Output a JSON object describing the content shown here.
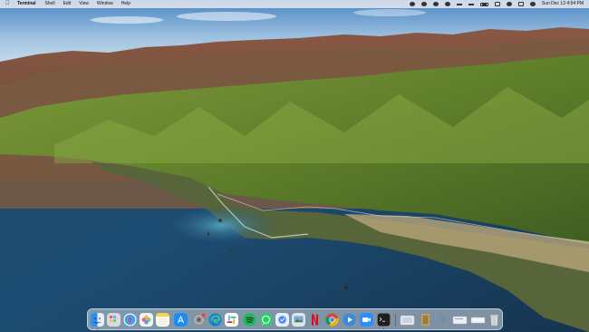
{
  "menubar": {
    "apple_icon": "apple-icon",
    "app_name": "Terminal",
    "menus": [
      "Shell",
      "Edit",
      "View",
      "Window",
      "Help"
    ],
    "status_icons": [
      "dropbox-icon",
      "clock-icon",
      "creative-cloud-icon",
      "dark-mode-icon",
      "bluetooth-icon",
      "volume-icon",
      "battery-icon",
      "wifi-icon",
      "search-icon",
      "control-center-icon",
      "siri-icon"
    ],
    "clock": "Sun Dec 13  4:54 PM"
  },
  "dock": {
    "apps": [
      {
        "name": "finder-icon",
        "color": "#2f8ff0"
      },
      {
        "name": "launchpad-icon",
        "color": "#d9d9de"
      },
      {
        "name": "safari-icon",
        "color": "#3aa2f0"
      },
      {
        "name": "photos-icon",
        "color": "#f4f4f4"
      },
      {
        "name": "notes-icon",
        "color": "#f7e38a"
      },
      {
        "name": "app-store-icon",
        "color": "#1c8cf5"
      },
      {
        "name": "system-preferences-icon",
        "color": "#8e8e93"
      },
      {
        "name": "edge-icon",
        "color": "#1a7dd7"
      },
      {
        "name": "slack-icon",
        "color": "#ffffff"
      },
      {
        "name": "spotify-icon",
        "color": "#1db954"
      },
      {
        "name": "whatsapp-icon",
        "color": "#25d366"
      },
      {
        "name": "things-icon",
        "color": "#e8eef6"
      },
      {
        "name": "preview-icon",
        "color": "#dfe5ec"
      },
      {
        "name": "netflix-icon",
        "color": "#e50914"
      },
      {
        "name": "chrome-icon",
        "color": "#f2f2f2"
      },
      {
        "name": "infuse-icon",
        "color": "#3a8bd8"
      },
      {
        "name": "zoom-icon",
        "color": "#2d8cff"
      },
      {
        "name": "terminal-icon",
        "color": "#1f1f1f"
      }
    ],
    "others": [
      {
        "name": "screenshot-folder-icon",
        "color": "#e8ecf0"
      },
      {
        "name": "downloads-stack-icon",
        "color": "#c9a45c"
      },
      {
        "name": "help-stack-icon",
        "color": "#d8dce2"
      },
      {
        "name": "documents-stack-icon",
        "color": "#eef1f4"
      },
      {
        "name": "window-stack-icon",
        "color": "#f4f4f4"
      },
      {
        "name": "trash-icon",
        "color": "#dadde1"
      }
    ]
  }
}
